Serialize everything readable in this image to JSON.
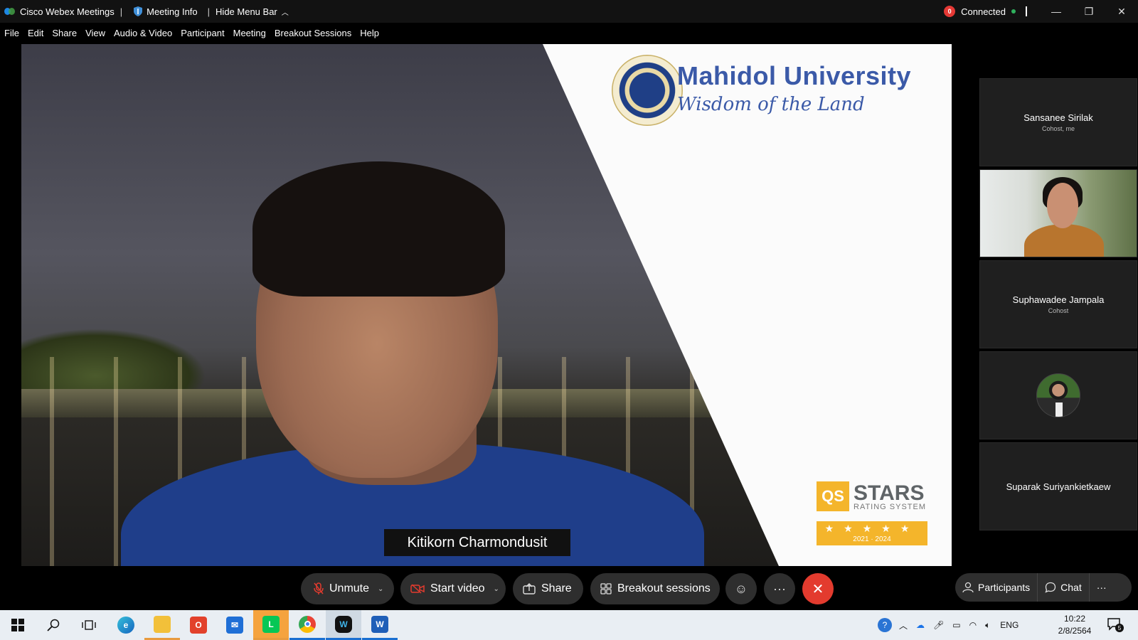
{
  "titlebar": {
    "app_title": "Cisco Webex Meetings",
    "meeting_info": "Meeting Info",
    "hide_menu_bar": "Hide Menu Bar",
    "record_badge": "0",
    "connection_status": "Connected",
    "accent_color": "#1e88e5"
  },
  "menu": {
    "items": [
      "File",
      "Edit",
      "Share",
      "View",
      "Audio & Video",
      "Participant",
      "Meeting",
      "Breakout Sessions",
      "Help"
    ]
  },
  "main_video": {
    "speaker_name": "Kitikorn Charmondusit",
    "background": {
      "university": "Mahidol University",
      "motto": "Wisdom of the Land",
      "badge_text": "QS",
      "stars_word": "STARS",
      "rating_subtitle": "RATING SYSTEM",
      "rating_years": "2021 · 2024",
      "stars": "★★★★★"
    }
  },
  "participants": [
    {
      "name": "Sansanee Sirilak",
      "role": "Cohost, me",
      "type": "name"
    },
    {
      "name": "",
      "role": "",
      "type": "video"
    },
    {
      "name": "Suphawadee Jampala",
      "role": "Cohost",
      "type": "name"
    },
    {
      "name": "",
      "role": "",
      "type": "avatar"
    },
    {
      "name": "Suparak Suriyankietkaew",
      "role": "",
      "type": "name"
    }
  ],
  "controls": {
    "unmute": "Unmute",
    "start_video": "Start video",
    "share": "Share",
    "breakout": "Breakout sessions",
    "end_color": "#e33b2e",
    "participants": "Participants",
    "chat": "Chat"
  },
  "taskbar": {
    "language": "ENG",
    "time": "10:22",
    "date": "2/8/2564",
    "notification_count": "5"
  }
}
